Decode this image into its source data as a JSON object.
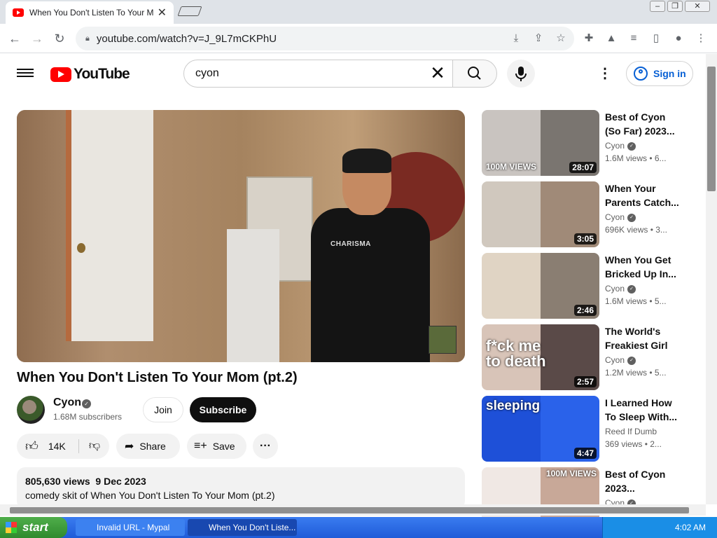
{
  "browser": {
    "tab_title": "When You Don't Listen To Your Mom",
    "url": "youtube.com/watch?v=J_9L7mCKPhU",
    "window_controls": [
      "minimize-icon",
      "restore-icon",
      "close-icon"
    ]
  },
  "youtube": {
    "logo_text": "YouTube",
    "search_value": "cyon",
    "signin_label": "Sign in"
  },
  "video": {
    "title": "When You Don't Listen To Your Mom (pt.2)",
    "shirt_text": "CHARISMA",
    "channel": "Cyon",
    "subscribers": "1.68M subscribers",
    "join_label": "Join",
    "subscribe_label": "Subscribe",
    "likes": "14K",
    "share_label": "Share",
    "save_label": "Save",
    "views_date": "805,630 views  9 Dec 2023",
    "description": "comedy skit of When You Don't Listen To Your Mom (pt.2)"
  },
  "related": [
    {
      "title": "Best of Cyon (So Far) 2023...",
      "channel": "Cyon",
      "verified": true,
      "meta": "1.6M views • 6...",
      "duration": "28:07",
      "overlay": "100M VIEWS",
      "color_a": "#c9c4c0",
      "color_b": "#7a7570"
    },
    {
      "title": "When Your Parents Catch...",
      "channel": "Cyon",
      "verified": true,
      "meta": "696K views • 3...",
      "duration": "3:05",
      "overlay": "",
      "color_a": "#d0c8be",
      "color_b": "#a08a78"
    },
    {
      "title": "When You Get Bricked Up In...",
      "channel": "Cyon",
      "verified": true,
      "meta": "1.6M views • 5...",
      "duration": "2:46",
      "overlay": "",
      "color_a": "#e0d4c4",
      "color_b": "#8a7e72"
    },
    {
      "title": "The World's Freakiest Girl",
      "channel": "Cyon",
      "verified": true,
      "meta": "1.2M views • 5...",
      "duration": "2:57",
      "overlay": "f*ck me to death",
      "color_a": "#d8c4b8",
      "color_b": "#5a4a48"
    },
    {
      "title": "I Learned How To Sleep With...",
      "channel": "Reed If Dumb",
      "verified": false,
      "meta": "369 views • 2...",
      "duration": "4:47",
      "overlay": "sleeping",
      "color_a": "#1e50d8",
      "color_b": "#2a62ea"
    },
    {
      "title": "Best of Cyon 2023...",
      "channel": "Cyon",
      "verified": true,
      "meta": "",
      "duration": "",
      "overlay": "100M VIEWS",
      "color_a": "#f0e8e4",
      "color_b": "#c8a898"
    }
  ],
  "taskbar": {
    "start_label": "start",
    "tasks": [
      "Invalid URL - Mypal",
      "When You Don't Liste..."
    ],
    "clock": "4:02 AM"
  }
}
